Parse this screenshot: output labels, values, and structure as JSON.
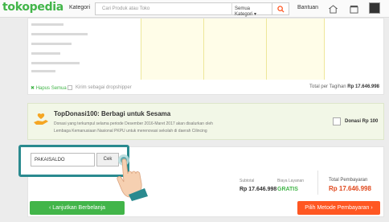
{
  "header": {
    "logo": "tokopedia",
    "kategori_label": "Kategori",
    "search_placeholder": "Cari Produk atau Toko",
    "search_category": "Semua Kategori ▾",
    "bantuan_label": "Bantuan"
  },
  "order": {
    "hapus_semua": "✖ Hapus Semua",
    "kirim_dropshipper": "Kirim sebagai dropshipper",
    "total_label": "Total per Tagihan",
    "total_value": "Rp 17.646.998"
  },
  "donasi": {
    "title": "TopDonasi100: Berbagi untuk Sesama",
    "line1": "Donasi yang terkumpul selama periode Desember 2016-Maret 2017 akan disalurkan oleh",
    "line2": "Lembaga Kemanusiaan Nasional PKPU untuk merenovasi sekolah di daerah Cilincing",
    "amount_label": "Donasi Rp 100"
  },
  "promo": {
    "code_value": "PAKAISALDO",
    "cek_label": "Cek"
  },
  "summary": {
    "subtotal_label": "Subtotal",
    "subtotal_value": "Rp 17.646.998",
    "biaya_label": "Biaya Layanan",
    "biaya_value": "GRATIS",
    "total_label": "Total Pembayaran",
    "total_value": "Rp 17.646.998"
  },
  "actions": {
    "back_label": "‹  Lanjutkan Berbelanja",
    "pay_label": "Pilih Metode Pembayaran  ›"
  },
  "colors": {
    "brand_green": "#42b549",
    "pay_orange": "#ff5722",
    "total_red": "#e0471b",
    "highlight_teal": "#2a8a8f"
  }
}
